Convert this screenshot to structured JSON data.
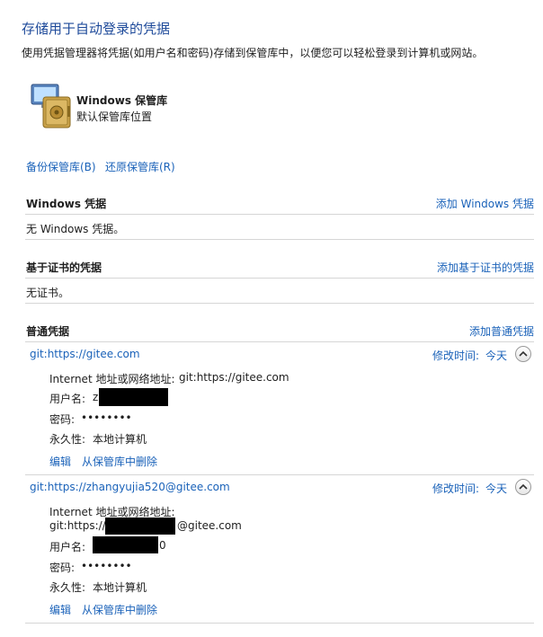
{
  "header": {
    "title": "存储用于自动登录的凭据",
    "description": "使用凭据管理器将凭据(如用户名和密码)存储到保管库中，以便您可以轻松登录到计算机或网站。"
  },
  "vault": {
    "icon": "vault-icon",
    "name": "Windows 保管库",
    "subtitle": "默认保管库位置"
  },
  "actions": {
    "backup": "备份保管库(B)",
    "restore": "还原保管库(R)"
  },
  "sections": {
    "windows": {
      "title": "Windows 凭据",
      "add": "添加 Windows 凭据",
      "empty": "无 Windows 凭据。"
    },
    "cert": {
      "title": "基于证书的凭据",
      "add": "添加基于证书的凭据",
      "empty": "无证书。"
    },
    "generic": {
      "title": "普通凭据",
      "add": "添加普通凭据"
    }
  },
  "credentials": [
    {
      "name": "git:https://gitee.com",
      "modified_label": "修改时间:",
      "modified_value": "今天",
      "address_label": "Internet 地址或网络地址:",
      "address_value": "git:https://gitee.com",
      "user_label": "用户名:",
      "user_value_visible": "z",
      "password_label": "密码:",
      "password_value": "••••••••",
      "persistence_label": "永久性:",
      "persistence_value": "本地计算机",
      "edit": "编辑",
      "remove": "从保管库中删除"
    },
    {
      "name": "git:https://zhangyujia520@gitee.com",
      "modified_label": "修改时间:",
      "modified_value": "今天",
      "address_label": "Internet 地址或网络地址:",
      "address_prefix": "git:https://",
      "address_suffix": "@gitee.com",
      "user_label": "用户名:",
      "user_value_visible": "0",
      "password_label": "密码:",
      "password_value": "••••••••",
      "persistence_label": "永久性:",
      "persistence_value": "本地计算机",
      "edit": "编辑",
      "remove": "从保管库中删除"
    }
  ],
  "colors": {
    "title": "#1e4a9a",
    "link": "#1a62b9",
    "divider": "#d6d6d6"
  }
}
